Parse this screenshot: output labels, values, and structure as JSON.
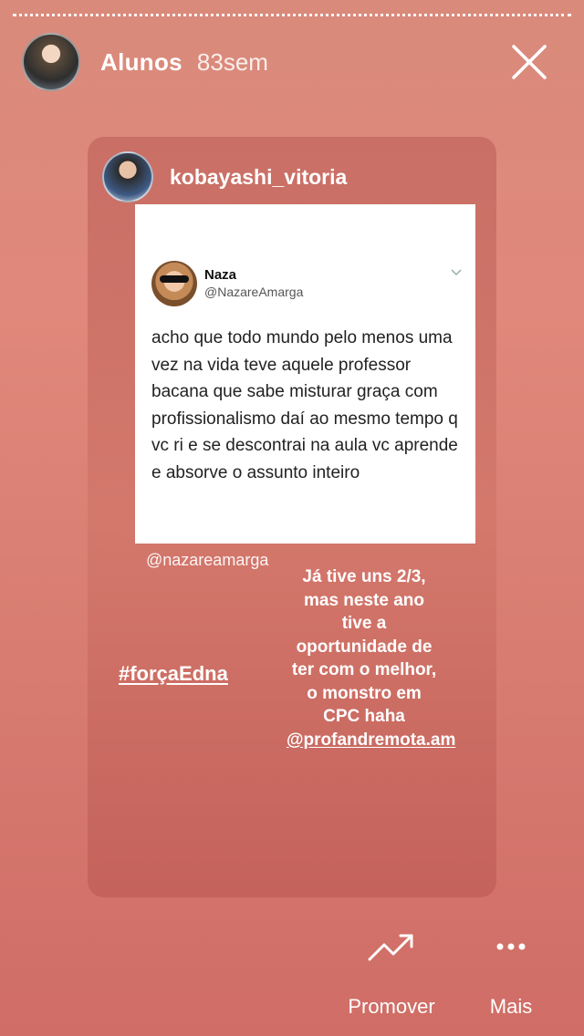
{
  "progress": {
    "segments": 1
  },
  "header": {
    "username": "Alunos",
    "time": "83sem"
  },
  "card": {
    "username": "kobayashi_vitoria",
    "tweet": {
      "name": "Naza",
      "handle": "@NazareAmarga",
      "text": "acho que todo mundo pelo menos uma vez na vida teve aquele professor bacana que sabe misturar graça com profissionalismo daí ao mesmo tempo q vc ri e se descontrai na aula vc aprende e absorve o assunto inteiro"
    },
    "mention": "@nazareamarga",
    "hashtag": "#forçaEdna",
    "caption": {
      "text": "Já tive uns 2/3, mas neste ano tive a oportunidade de ter com o melhor, o monstro em CPC haha",
      "mention": "@profandremota.am"
    }
  },
  "footer": {
    "promote_label": "Promover",
    "more_label": "Mais"
  },
  "icons": {
    "close": "close-icon",
    "promote": "trend-up-icon",
    "more": "more-dots-icon",
    "chevron": "chevron-down-icon"
  }
}
